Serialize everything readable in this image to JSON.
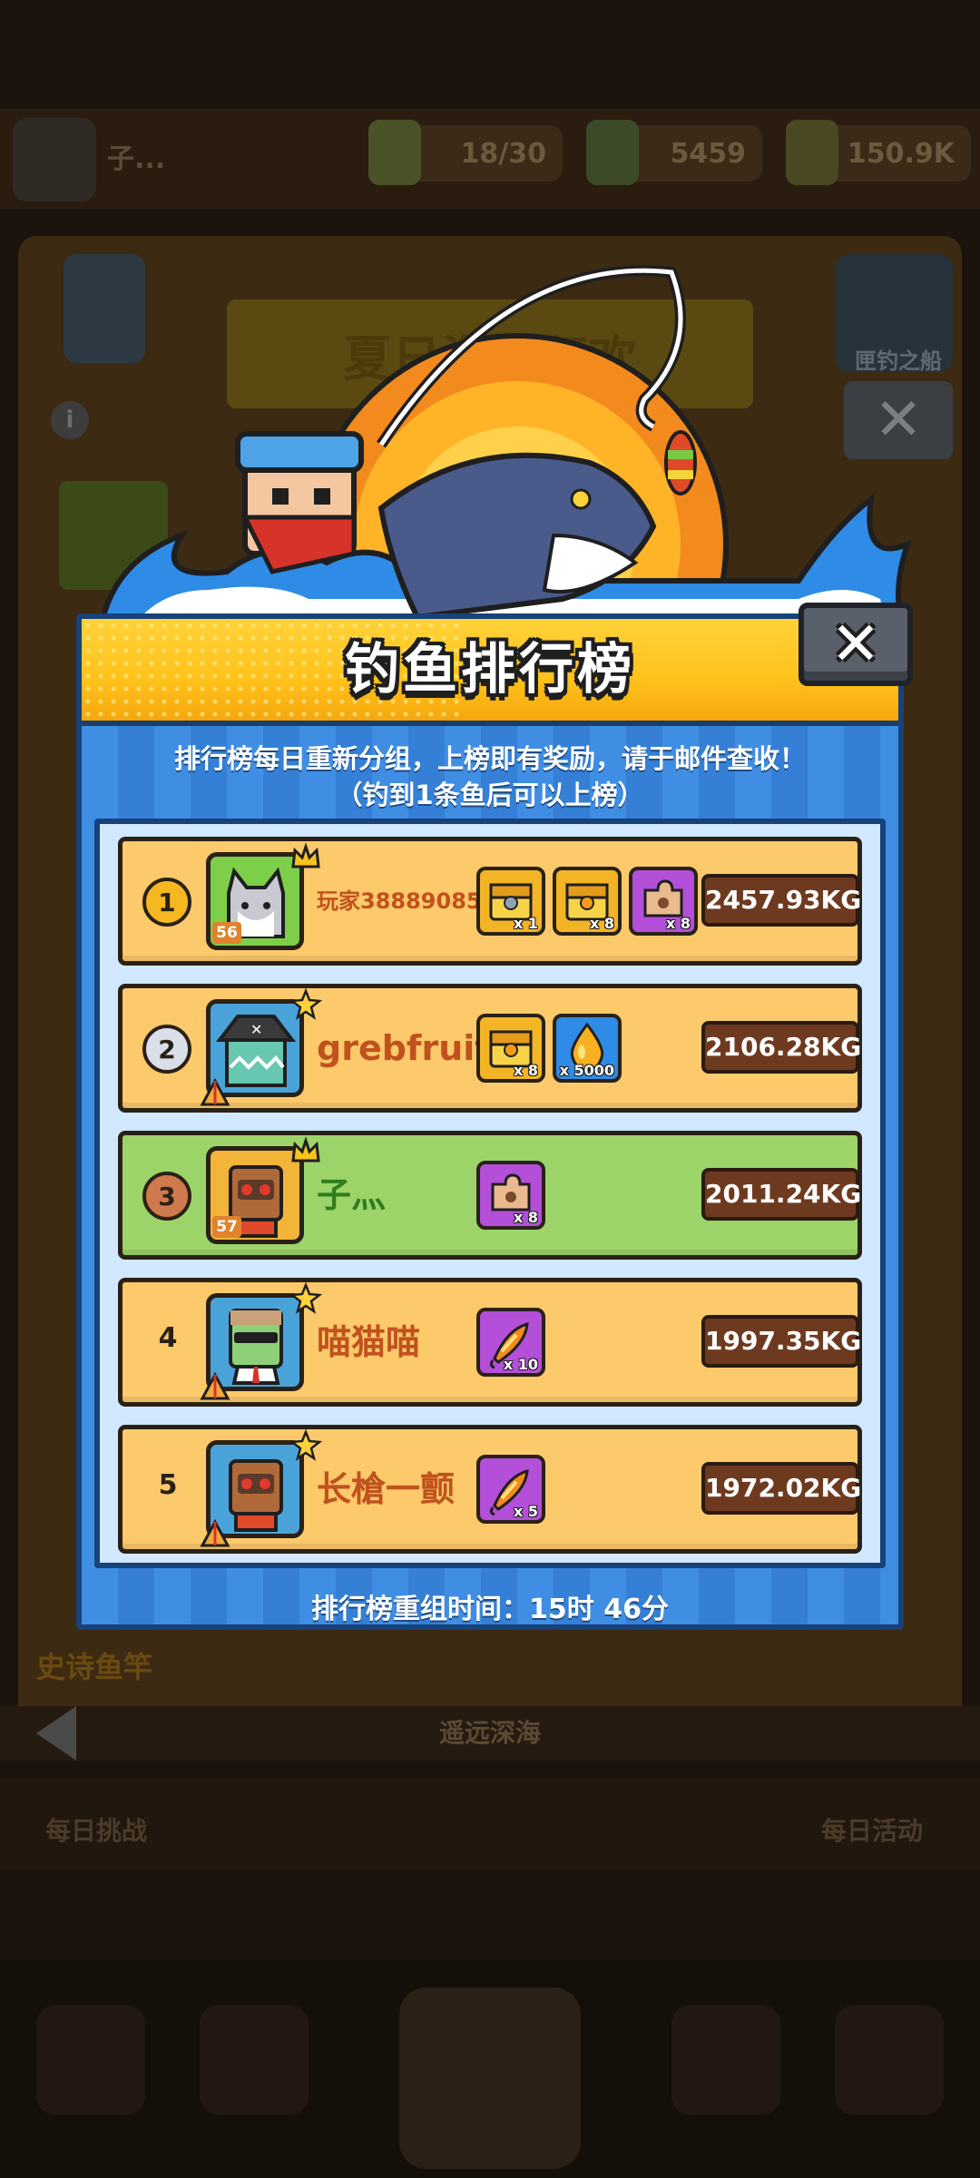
{
  "background": {
    "resources": [
      {
        "name": "energy",
        "value": "18/30",
        "icon": "energy-icon"
      },
      {
        "name": "coins",
        "value": "5459",
        "icon": "coin-icon"
      },
      {
        "name": "power",
        "value": "150.9K",
        "icon": "power-icon"
      }
    ],
    "player_short": "子...",
    "banner": "夏日海钓狂欢",
    "shield_label": "匣钓之船",
    "epic_rod": "史诗鱼竿",
    "location": "遥远深海",
    "daily_left": "每日挑战",
    "daily_right": "每日活动"
  },
  "modal": {
    "title": "钓鱼排行榜",
    "desc_line1": "排行榜每日重新分组，上榜即有奖励，请于邮件查收！",
    "desc_line2": "（钓到1条鱼后可以上榜）",
    "reset_label": "排行榜重组时间：",
    "reset_time": "15时 46分",
    "close_icon": "close-icon",
    "colors": {
      "header": "#ffc21b",
      "panel": "#3a86dd",
      "row": "#fcc96b",
      "row_mine": "#9cd46a",
      "name": "#c0521e"
    }
  },
  "leaderboard": [
    {
      "rank": "1",
      "medal": "gold",
      "name": "玩家38889085",
      "level": "56",
      "avatar": "cat-avatar",
      "weight": "2457.93KG",
      "mine": false,
      "rewards": [
        {
          "icon": "gold-chest-icon",
          "qty": "x 1"
        },
        {
          "icon": "gold-chest-icon",
          "qty": "x 8"
        },
        {
          "icon": "puzzle-icon",
          "qty": "x 8"
        }
      ]
    },
    {
      "rank": "2",
      "medal": "silver",
      "name": "grebfruit",
      "level": "",
      "avatar": "pirate-avatar",
      "weight": "2106.28KG",
      "mine": false,
      "rewards": [
        {
          "icon": "gold-chest-icon",
          "qty": "x 8"
        },
        {
          "icon": "oil-drop-icon",
          "qty": "x 5000"
        }
      ]
    },
    {
      "rank": "3",
      "medal": "bronze",
      "name": "子灬",
      "level": "57",
      "avatar": "robot-avatar",
      "weight": "2011.24KG",
      "mine": true,
      "rewards": [
        {
          "icon": "puzzle-icon",
          "qty": "x 8"
        }
      ]
    },
    {
      "rank": "4",
      "medal": "none",
      "name": "喵猫喵",
      "level": "",
      "avatar": "zombie-avatar",
      "weight": "1997.35KG",
      "mine": false,
      "rewards": [
        {
          "icon": "fishing-lure-icon",
          "qty": "x 10"
        }
      ]
    },
    {
      "rank": "5",
      "medal": "none",
      "name": "长槍一颤",
      "level": "",
      "avatar": "robot-avatar",
      "weight": "1972.02KG",
      "mine": false,
      "rewards": [
        {
          "icon": "fishing-lure-icon",
          "qty": "x 5"
        }
      ]
    }
  ]
}
